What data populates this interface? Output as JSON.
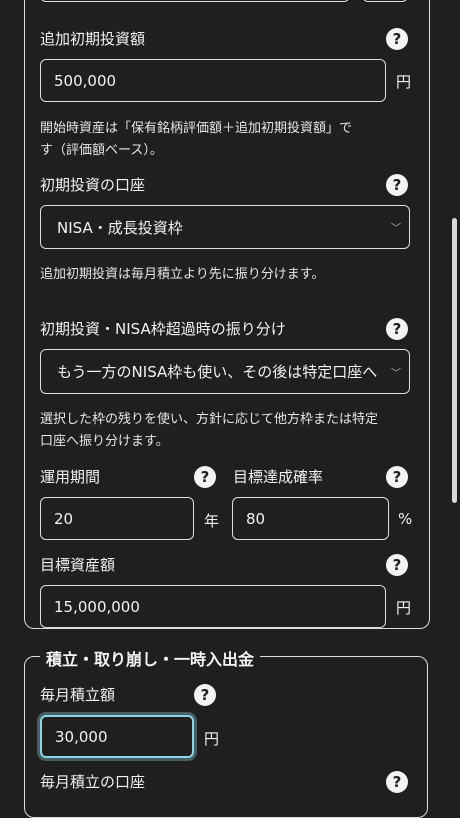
{
  "initial": {
    "label": "追加初期投資額",
    "value": "500,000",
    "unit": "円",
    "note_line1": "開始時資産は「保有銘柄評価額＋追加初期投資額」で",
    "note_line2": "す（評価額ベース）。"
  },
  "account": {
    "label": "初期投資の口座",
    "selected": "NISA・成長投資枠",
    "note": "追加初期投資は毎月積立より先に振り分けます。"
  },
  "overflow": {
    "label": "初期投資・NISA枠超過時の振り分け",
    "selected": "もう一方のNISA枠も使い、その後は特定口座へ",
    "note_line1": "選択した枠の残りを使い、方針に応じて他方枠または特定",
    "note_line2": "口座へ振り分けます。"
  },
  "period": {
    "label": "運用期間",
    "value": "20",
    "unit": "年"
  },
  "probability": {
    "label": "目標達成確率",
    "value": "80",
    "unit": "%"
  },
  "target": {
    "label": "目標資産額",
    "value": "15,000,000",
    "unit": "円"
  },
  "section2": {
    "title": "積立・取り崩し・一時入出金",
    "monthly": {
      "label": "毎月積立額",
      "value": "30,000",
      "unit": "円"
    },
    "monthly_account": {
      "label": "毎月積立の口座"
    }
  },
  "help_glyph": "?",
  "chevron_glyph": "﹀"
}
